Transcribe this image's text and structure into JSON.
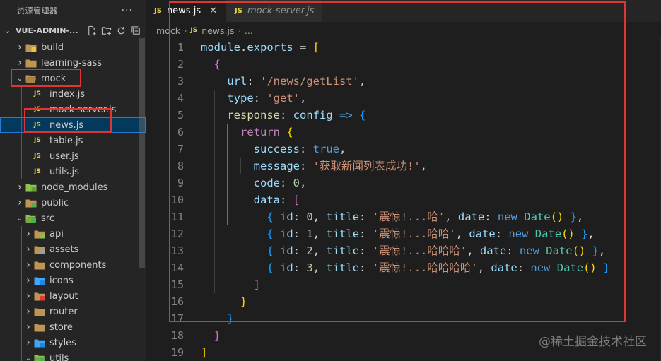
{
  "sidebar": {
    "title": "资源管理器",
    "more": "···",
    "project": "VUE-ADMIN-...",
    "items": [
      {
        "label": "build",
        "type": "folder",
        "depth": 1,
        "open": false,
        "icon": "folder-build-icon"
      },
      {
        "label": "learning-sass",
        "type": "folder",
        "depth": 1,
        "open": false,
        "icon": "folder-icon"
      },
      {
        "label": "mock",
        "type": "folder",
        "depth": 1,
        "open": true,
        "icon": "folder-open-icon"
      },
      {
        "label": "index.js",
        "type": "js",
        "depth": 2
      },
      {
        "label": "mock-server.js",
        "type": "js",
        "depth": 2
      },
      {
        "label": "news.js",
        "type": "js",
        "depth": 2,
        "selected": true
      },
      {
        "label": "table.js",
        "type": "js",
        "depth": 2
      },
      {
        "label": "user.js",
        "type": "js",
        "depth": 2
      },
      {
        "label": "utils.js",
        "type": "js",
        "depth": 2
      },
      {
        "label": "node_modules",
        "type": "folder",
        "depth": 1,
        "open": false,
        "icon": "folder-node-icon"
      },
      {
        "label": "public",
        "type": "folder",
        "depth": 1,
        "open": false,
        "icon": "folder-public-icon"
      },
      {
        "label": "src",
        "type": "folder",
        "depth": 1,
        "open": true,
        "icon": "folder-src-icon"
      },
      {
        "label": "api",
        "type": "folder",
        "depth": 2,
        "open": false,
        "icon": "folder-api-icon"
      },
      {
        "label": "assets",
        "type": "folder",
        "depth": 2,
        "open": false,
        "icon": "folder-assets-icon"
      },
      {
        "label": "components",
        "type": "folder",
        "depth": 2,
        "open": false,
        "icon": "folder-components-icon"
      },
      {
        "label": "icons",
        "type": "folder",
        "depth": 2,
        "open": false,
        "icon": "folder-icons-icon"
      },
      {
        "label": "layout",
        "type": "folder",
        "depth": 2,
        "open": false,
        "icon": "folder-layout-icon"
      },
      {
        "label": "router",
        "type": "folder",
        "depth": 2,
        "open": false,
        "icon": "folder-router-icon"
      },
      {
        "label": "store",
        "type": "folder",
        "depth": 2,
        "open": false,
        "icon": "folder-store-icon"
      },
      {
        "label": "styles",
        "type": "folder",
        "depth": 2,
        "open": false,
        "icon": "folder-styles-icon"
      },
      {
        "label": "utils",
        "type": "folder",
        "depth": 2,
        "open": true,
        "icon": "folder-utils-icon"
      }
    ]
  },
  "tabs": [
    {
      "label": "news.js",
      "badge": "JS",
      "active": true,
      "close": "✕"
    },
    {
      "label": "mock-server.js",
      "badge": "JS",
      "active": false
    }
  ],
  "breadcrumb": {
    "folder": "mock",
    "file": "news.js",
    "badge": "JS",
    "tail": "..."
  },
  "code": {
    "lines": [
      [
        [
          "t-var",
          "module"
        ],
        [
          "t-punc",
          "."
        ],
        [
          "t-var",
          "exports"
        ],
        [
          "t-punc",
          " = "
        ],
        [
          "b1",
          "["
        ]
      ],
      [
        [
          "t-punc",
          "  "
        ],
        [
          "b2",
          "{"
        ]
      ],
      [
        [
          "t-punc",
          "    "
        ],
        [
          "t-var",
          "url"
        ],
        [
          "t-punc",
          ": "
        ],
        [
          "t-str",
          "'/news/getList'"
        ],
        [
          "t-punc",
          ","
        ]
      ],
      [
        [
          "t-punc",
          "    "
        ],
        [
          "t-var",
          "type"
        ],
        [
          "t-punc",
          ": "
        ],
        [
          "t-str",
          "'get'"
        ],
        [
          "t-punc",
          ","
        ]
      ],
      [
        [
          "t-punc",
          "    "
        ],
        [
          "t-fn",
          "response"
        ],
        [
          "t-punc",
          ": "
        ],
        [
          "t-var",
          "config"
        ],
        [
          "t-punc",
          " "
        ],
        [
          "t-kw",
          "=>"
        ],
        [
          "t-punc",
          " "
        ],
        [
          "b3",
          "{"
        ]
      ],
      [
        [
          "t-punc",
          "      "
        ],
        [
          "t-kw2",
          "return"
        ],
        [
          "t-punc",
          " "
        ],
        [
          "b1",
          "{"
        ]
      ],
      [
        [
          "t-punc",
          "        "
        ],
        [
          "t-var",
          "success"
        ],
        [
          "t-punc",
          ": "
        ],
        [
          "t-kw",
          "true"
        ],
        [
          "t-punc",
          ","
        ]
      ],
      [
        [
          "t-punc",
          "        "
        ],
        [
          "t-var",
          "message"
        ],
        [
          "t-punc",
          ": "
        ],
        [
          "t-str",
          "'获取新闻列表成功!'"
        ],
        [
          "t-punc",
          ","
        ]
      ],
      [
        [
          "t-punc",
          "        "
        ],
        [
          "t-var",
          "code"
        ],
        [
          "t-punc",
          ": "
        ],
        [
          "t-num",
          "0"
        ],
        [
          "t-punc",
          ","
        ]
      ],
      [
        [
          "t-punc",
          "        "
        ],
        [
          "t-var",
          "data"
        ],
        [
          "t-punc",
          ": "
        ],
        [
          "b2",
          "["
        ]
      ],
      [
        [
          "t-punc",
          "          "
        ],
        [
          "b3",
          "{"
        ],
        [
          "t-punc",
          " "
        ],
        [
          "t-var",
          "id"
        ],
        [
          "t-punc",
          ": "
        ],
        [
          "t-num",
          "0"
        ],
        [
          "t-punc",
          ", "
        ],
        [
          "t-var",
          "title"
        ],
        [
          "t-punc",
          ": "
        ],
        [
          "t-str",
          "'震惊!...哈'"
        ],
        [
          "t-punc",
          ", "
        ],
        [
          "t-var",
          "date"
        ],
        [
          "t-punc",
          ": "
        ],
        [
          "t-kw",
          "new"
        ],
        [
          "t-punc",
          " "
        ],
        [
          "t-cls",
          "Date"
        ],
        [
          "b1",
          "()"
        ],
        [
          "t-punc",
          " "
        ],
        [
          "b3",
          "}"
        ],
        [
          "t-punc",
          ","
        ]
      ],
      [
        [
          "t-punc",
          "          "
        ],
        [
          "b3",
          "{"
        ],
        [
          "t-punc",
          " "
        ],
        [
          "t-var",
          "id"
        ],
        [
          "t-punc",
          ": "
        ],
        [
          "t-num",
          "1"
        ],
        [
          "t-punc",
          ", "
        ],
        [
          "t-var",
          "title"
        ],
        [
          "t-punc",
          ": "
        ],
        [
          "t-str",
          "'震惊!...哈哈'"
        ],
        [
          "t-punc",
          ", "
        ],
        [
          "t-var",
          "date"
        ],
        [
          "t-punc",
          ": "
        ],
        [
          "t-kw",
          "new"
        ],
        [
          "t-punc",
          " "
        ],
        [
          "t-cls",
          "Date"
        ],
        [
          "b1",
          "()"
        ],
        [
          "t-punc",
          " "
        ],
        [
          "b3",
          "}"
        ],
        [
          "t-punc",
          ","
        ]
      ],
      [
        [
          "t-punc",
          "          "
        ],
        [
          "b3",
          "{"
        ],
        [
          "t-punc",
          " "
        ],
        [
          "t-var",
          "id"
        ],
        [
          "t-punc",
          ": "
        ],
        [
          "t-num",
          "2"
        ],
        [
          "t-punc",
          ", "
        ],
        [
          "t-var",
          "title"
        ],
        [
          "t-punc",
          ": "
        ],
        [
          "t-str",
          "'震惊!...哈哈哈'"
        ],
        [
          "t-punc",
          ", "
        ],
        [
          "t-var",
          "date"
        ],
        [
          "t-punc",
          ": "
        ],
        [
          "t-kw",
          "new"
        ],
        [
          "t-punc",
          " "
        ],
        [
          "t-cls",
          "Date"
        ],
        [
          "b1",
          "()"
        ],
        [
          "t-punc",
          " "
        ],
        [
          "b3",
          "}"
        ],
        [
          "t-punc",
          ","
        ]
      ],
      [
        [
          "t-punc",
          "          "
        ],
        [
          "b3",
          "{"
        ],
        [
          "t-punc",
          " "
        ],
        [
          "t-var",
          "id"
        ],
        [
          "t-punc",
          ": "
        ],
        [
          "t-num",
          "3"
        ],
        [
          "t-punc",
          ", "
        ],
        [
          "t-var",
          "title"
        ],
        [
          "t-punc",
          ": "
        ],
        [
          "t-str",
          "'震惊!...哈哈哈哈'"
        ],
        [
          "t-punc",
          ", "
        ],
        [
          "t-var",
          "date"
        ],
        [
          "t-punc",
          ": "
        ],
        [
          "t-kw",
          "new"
        ],
        [
          "t-punc",
          " "
        ],
        [
          "t-cls",
          "Date"
        ],
        [
          "b1",
          "()"
        ],
        [
          "t-punc",
          " "
        ],
        [
          "b3",
          "}"
        ]
      ],
      [
        [
          "t-punc",
          "        "
        ],
        [
          "b2",
          "]"
        ]
      ],
      [
        [
          "t-punc",
          "      "
        ],
        [
          "b1",
          "}"
        ]
      ],
      [
        [
          "t-punc",
          "    "
        ],
        [
          "b3",
          "}"
        ]
      ],
      [
        [
          "t-punc",
          "  "
        ],
        [
          "b2",
          "}"
        ]
      ],
      [
        [
          "b1",
          "]"
        ]
      ]
    ]
  },
  "watermark": "@稀土掘金技术社区",
  "colors": {
    "highlight_box": "#e03535",
    "accent": "#2b79d0",
    "js_badge": "#e8d44d"
  }
}
